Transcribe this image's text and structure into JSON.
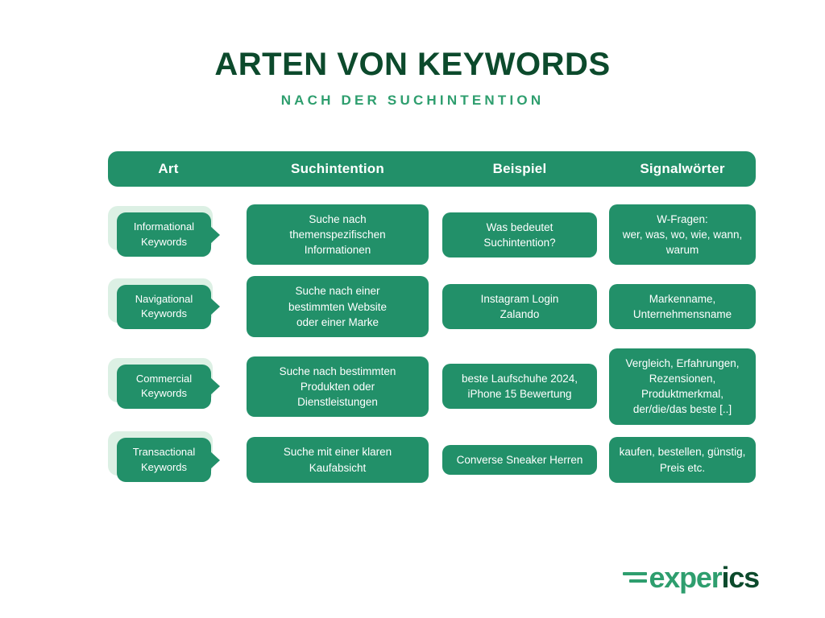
{
  "header": {
    "title": "ARTEN VON KEYWORDS",
    "subtitle": "NACH DER SUCHINTENTION"
  },
  "colors": {
    "brand_green": "#229069",
    "dark_green": "#0c4a2c",
    "accent_green": "#2e9e6e",
    "pale_green": "#dcf0e4",
    "background": "#ffffff",
    "text_on_green": "#ffffff"
  },
  "table": {
    "columns": [
      {
        "key": "art",
        "label": "Art"
      },
      {
        "key": "suchintention",
        "label": "Suchintention"
      },
      {
        "key": "beispiel",
        "label": "Beispiel"
      },
      {
        "key": "signalwoerter",
        "label": "Signalwörter"
      }
    ],
    "rows": [
      {
        "art": "Informational\nKeywords",
        "suchintention": "Suche nach\nthemenspezifischen\nInformationen",
        "beispiel": "Was bedeutet\nSuchintention?",
        "signalwoerter": "W-Fragen:\nwer, was, wo, wie, wann, warum"
      },
      {
        "art": "Navigational\nKeywords",
        "suchintention": "Suche nach einer\nbestimmten Website\noder einer Marke",
        "beispiel": "Instagram Login\nZalando",
        "signalwoerter": "Markenname,\nUnternehmensname"
      },
      {
        "art": "Commercial\nKeywords",
        "suchintention": "Suche nach bestimmten\nProdukten oder\nDienstleistungen",
        "beispiel": "beste Laufschuhe 2024,\niPhone 15 Bewertung",
        "signalwoerter": "Vergleich, Erfahrungen,\nRezensionen, Produktmerkmal,\nder/die/das beste [..]"
      },
      {
        "art": "Transactional\nKeywords",
        "suchintention": "Suche mit einer klaren\nKaufabsicht",
        "beispiel": "Converse Sneaker Herren",
        "signalwoerter": "kaufen, bestellen, günstig,\nPreis etc."
      }
    ]
  },
  "logo": {
    "part1": "exper",
    "part2": "ics"
  }
}
